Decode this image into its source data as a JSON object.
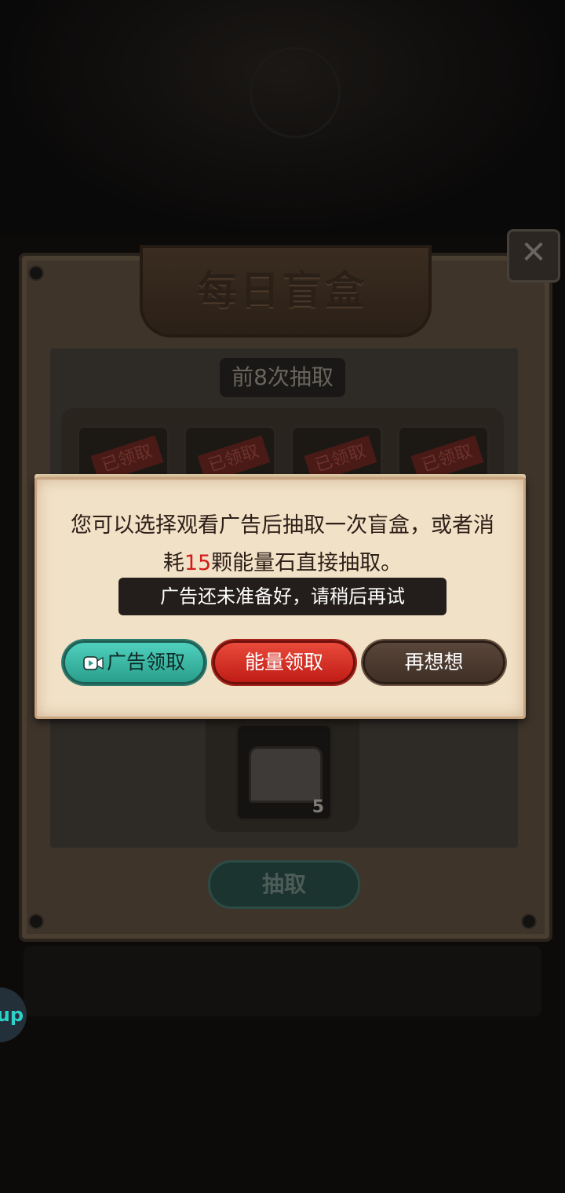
{
  "panel": {
    "title": "每日盲盒",
    "draw_label": "前8次抽取",
    "card_tag": "已领取",
    "chest_count": "5",
    "draw_button": "抽取"
  },
  "dialog": {
    "message_before": "您可以选择观看广告后抽取一次盲盒，或者消耗",
    "energy_amount": "15",
    "message_after": "颗能量石直接抽取。",
    "toast": "广告还未准备好，请稍后再试",
    "buttons": {
      "ad": "广告领取",
      "energy": "能量领取",
      "later": "再想想"
    }
  },
  "side_badge": "up",
  "colors": {
    "accent_red": "#d21c18",
    "ad_button": "#3bbfa9",
    "energy_button": "#d8302a",
    "later_button": "#4c3a2f"
  },
  "icons": [
    "close-icon",
    "video-icon",
    "chest-icon"
  ]
}
